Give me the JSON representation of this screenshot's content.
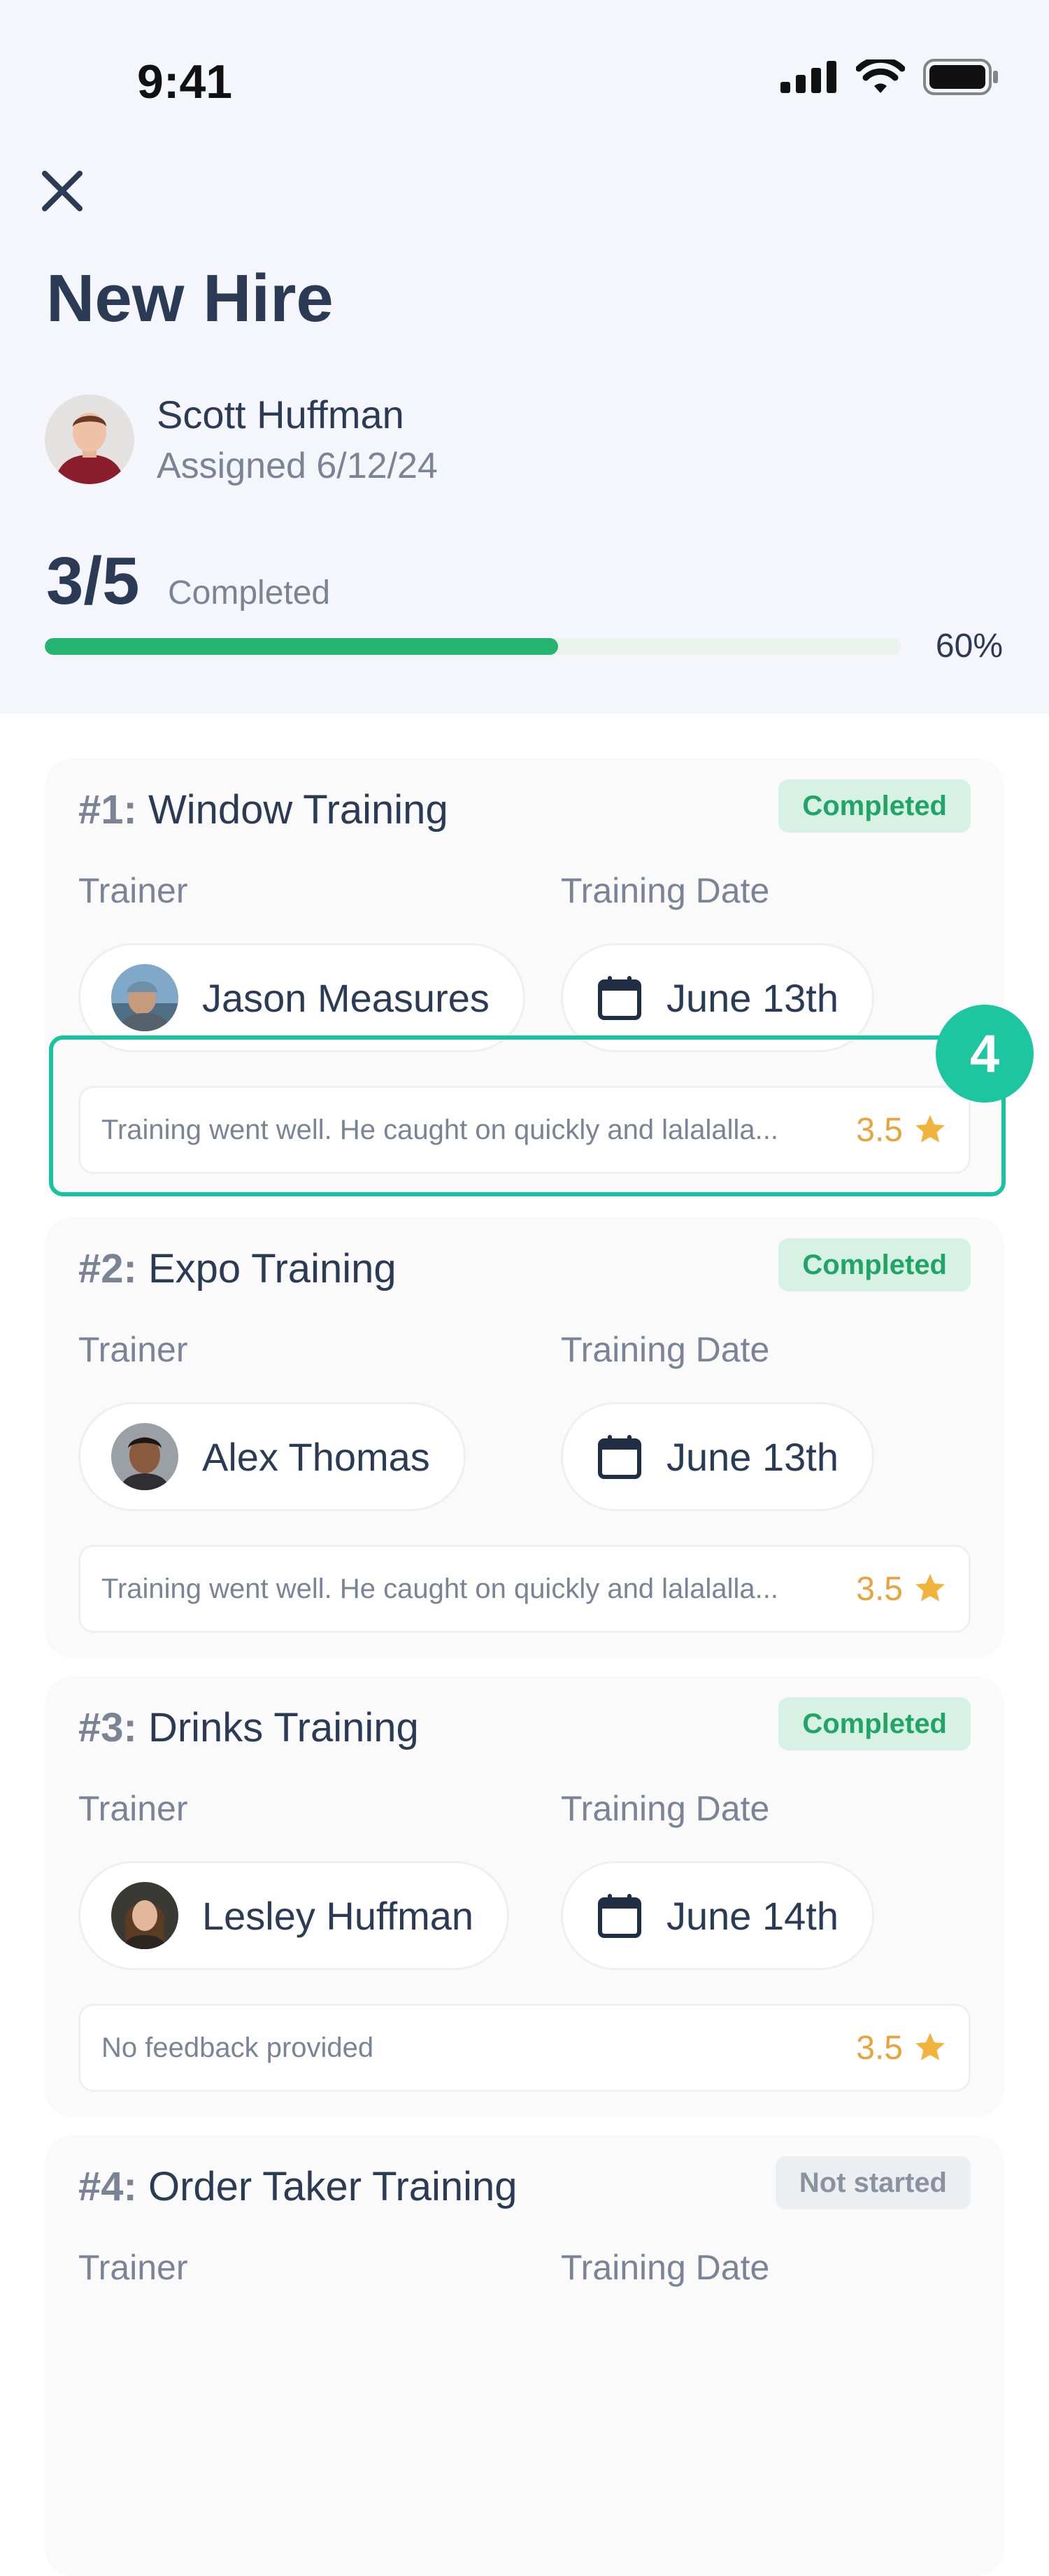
{
  "status_bar": {
    "time": "9:41"
  },
  "header": {
    "title": "New Hire",
    "hire": {
      "name": "Scott Huffman",
      "assigned": "Assigned 6/12/24"
    },
    "progress": {
      "count": "3/5",
      "label": "Completed",
      "percent_text": "60%",
      "fraction": 0.6
    }
  },
  "labels": {
    "trainer": "Trainer",
    "training_date": "Training Date"
  },
  "trainings": [
    {
      "number": "#1:",
      "title": "Window Training",
      "status": "Completed",
      "trainer": "Jason Measures",
      "date": "June 13th",
      "feedback": "Training went well. He caught on quickly and lalalalla...",
      "rating": "3.5"
    },
    {
      "number": "#2:",
      "title": "Expo Training",
      "status": "Completed",
      "trainer": "Alex Thomas",
      "date": "June 13th",
      "feedback": "Training went well. He caught on quickly and lalalalla...",
      "rating": "3.5"
    },
    {
      "number": "#3:",
      "title": "Drinks Training",
      "status": "Completed",
      "trainer": "Lesley Huffman",
      "date": "June 14th",
      "feedback": "No feedback provided",
      "rating": "3.5"
    },
    {
      "number": "#4:",
      "title": "Order Taker Training",
      "status": "Not started",
      "trainer": "",
      "date": "",
      "feedback": "",
      "rating": ""
    }
  ],
  "annotation": {
    "step": "4"
  },
  "colors": {
    "accent": "#25b46f",
    "highlight": "#1ec5a1",
    "star": "#f2b33d",
    "text": "#2b3a55"
  }
}
